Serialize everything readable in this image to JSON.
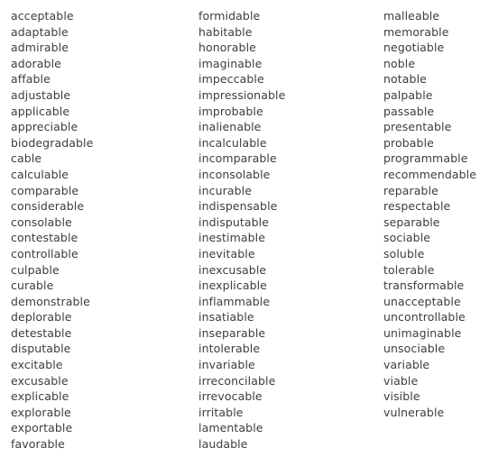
{
  "page": {
    "background_color": "#ffffff",
    "text_color": "#3d3d3d",
    "layout": "three-column-word-list"
  },
  "columns": [
    {
      "name": "column-1",
      "words": [
        "acceptable",
        "adaptable",
        "admirable",
        "adorable",
        "affable",
        "adjustable",
        "applicable",
        "appreciable",
        "biodegradable",
        "cable",
        "calculable",
        "comparable",
        "considerable",
        "consolable",
        "contestable",
        "controllable",
        "culpable",
        "curable",
        "demonstrable",
        "deplorable",
        "detestable",
        "disputable",
        "excitable",
        "excusable",
        "explicable",
        "explorable",
        "exportable",
        "favorable"
      ]
    },
    {
      "name": "column-2",
      "words": [
        "formidable",
        "habitable",
        "honorable",
        "imaginable",
        "impeccable",
        "impressionable",
        "improbable",
        "inalienable",
        "incalculable",
        "incomparable",
        "inconsolable",
        "incurable",
        "indispensable",
        "indisputable",
        "inestimable",
        "inevitable",
        "inexcusable",
        "inexplicable",
        "inflammable",
        "insatiable",
        "inseparable",
        "intolerable",
        "invariable",
        "irreconcilable",
        "irrevocable",
        "irritable",
        "lamentable",
        "laudable"
      ]
    },
    {
      "name": "column-3",
      "words": [
        "malleable",
        "memorable",
        "negotiable",
        "noble",
        "notable",
        "palpable",
        "passable",
        "presentable",
        "probable",
        "programmable",
        "recommendable",
        "reparable",
        "respectable",
        "separable",
        "sociable",
        "soluble",
        "tolerable",
        "transformable",
        "unacceptable",
        "uncontrollable",
        "unimaginable",
        "unsociable",
        "variable",
        "viable",
        "visible",
        "vulnerable"
      ]
    }
  ]
}
